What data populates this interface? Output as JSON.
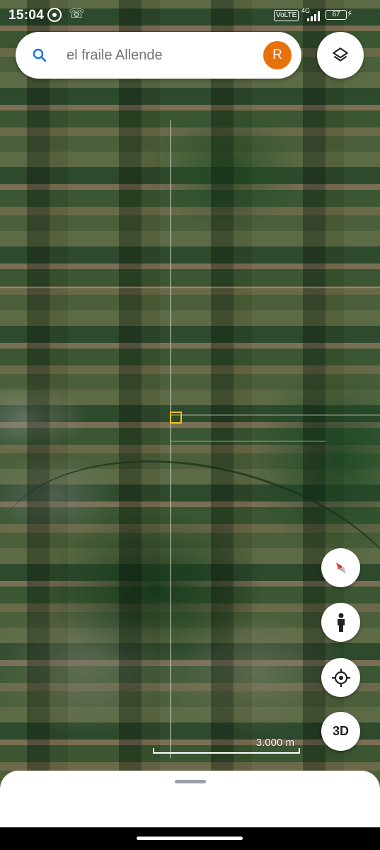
{
  "status_bar": {
    "time": "15:04",
    "volte": "VoLTE",
    "network": "4G",
    "battery": "67",
    "icons": [
      "whatsapp-icon",
      "call-icon",
      "signal-icon",
      "battery-icon",
      "charging-icon"
    ]
  },
  "search": {
    "query": "el fraile Allende",
    "avatar_initial": "R",
    "avatar_color": "#e8710a",
    "search_icon_color": "#1a73e8"
  },
  "map": {
    "scale_label": "3.000 m",
    "marker_color": "#f2c21a"
  },
  "controls": {
    "three_d_label": "3D",
    "buttons": [
      "layers-icon",
      "compass-icon",
      "street-view-icon",
      "my-location-icon"
    ]
  }
}
